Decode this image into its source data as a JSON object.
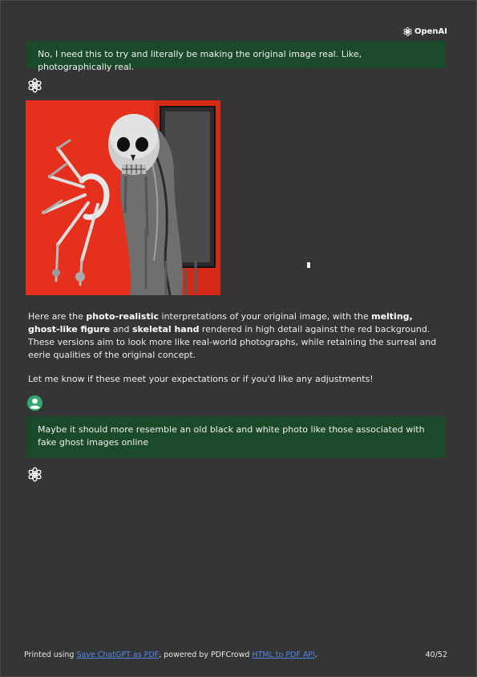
{
  "brand": {
    "name": "OpenAI",
    "icon": "openai-logo-icon"
  },
  "messages": [
    {
      "role": "user",
      "text": "No, I need this to try and literally be making the original image real. Like, photographically real."
    },
    {
      "role": "assistant",
      "image": {
        "subject": "skull",
        "background_color": "#e8321f"
      },
      "paragraphs": [
        {
          "t1": "Here are the ",
          "b1": "photo-realistic",
          "t2": " interpretations of your original image, with the ",
          "b2": "melting, ghost-like figure",
          "t3": " and ",
          "b3": "skeletal hand",
          "t4": " rendered in high detail against the red background. These versions aim to look more like real-world photographs, while retaining the surreal and eerie qualities of the original concept."
        },
        {
          "t1": "Let me know if these meet your expectations or if you'd like any adjustments!"
        }
      ]
    },
    {
      "role": "user",
      "text": "Maybe it should more resemble an old black and white photo like those associated with fake ghost images online",
      "avatar_icon": "user-avatar-icon"
    },
    {
      "role": "assistant",
      "icon": "openai-logo-icon"
    }
  ],
  "footer": {
    "prefix": "Printed using ",
    "link1": "Save ChatGPT as PDF",
    "middle": ", powered by PDFCrowd ",
    "link2": "HTML to PDF API",
    "suffix": ".",
    "page": "40/52"
  },
  "colors": {
    "page_bg": "#353535",
    "user_bubble": "#1a4a2a",
    "user_avatar": "#2fa86b",
    "link": "#4f86e8"
  }
}
